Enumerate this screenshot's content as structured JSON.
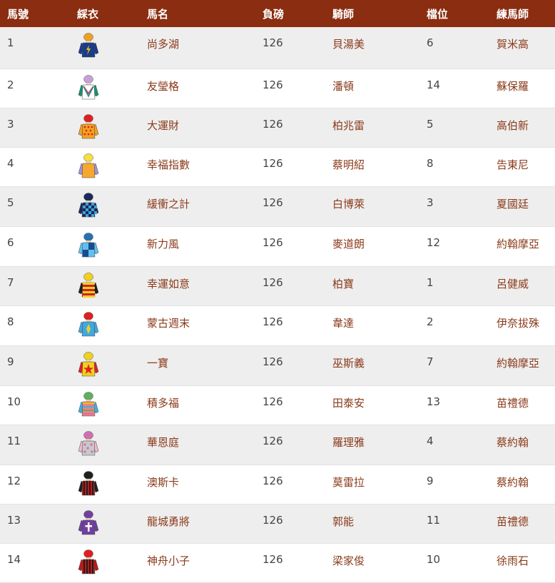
{
  "header": {
    "number": "馬號",
    "silks": "綵衣",
    "horse": "馬名",
    "weight": "負磅",
    "jockey": "騎師",
    "draw": "檔位",
    "trainer": "練馬師"
  },
  "rows": [
    {
      "number": "1",
      "horse": "尚多湖",
      "weight": "126",
      "jockey": "貝湯美",
      "draw": "6",
      "trainer": "賀米高",
      "silk": {
        "icon": "jockey-silks-icon",
        "cap": "#f0a020",
        "body": "#1a3c8c",
        "sleeve": "#1a3c8c",
        "accent": "#f2c200",
        "pattern": "bolt"
      }
    },
    {
      "number": "2",
      "horse": "友瑩格",
      "weight": "126",
      "jockey": "潘頓",
      "draw": "14",
      "trainer": "蘇保羅",
      "silk": {
        "icon": "jockey-silks-icon",
        "cap": "#c8a0d8",
        "body": "#ffffff",
        "sleeve": "#1a9070",
        "accent": "#d04080",
        "pattern": "chevron"
      }
    },
    {
      "number": "3",
      "horse": "大運財",
      "weight": "126",
      "jockey": "柏兆雷",
      "draw": "5",
      "trainer": "高伯新",
      "silk": {
        "icon": "jockey-silks-icon",
        "cap": "#e02020",
        "body": "#f5a020",
        "sleeve": "#f5a020",
        "accent": "#d02020",
        "pattern": "dots"
      }
    },
    {
      "number": "4",
      "horse": "幸福指數",
      "weight": "126",
      "jockey": "蔡明紹",
      "draw": "8",
      "trainer": "告東尼",
      "silk": {
        "icon": "jockey-silks-icon",
        "cap": "#f5e040",
        "body": "#f5a830",
        "sleeve": "#a890d8",
        "accent": "#e07020",
        "pattern": "plain"
      }
    },
    {
      "number": "5",
      "horse": "緩衝之計",
      "weight": "126",
      "jockey": "白博萊",
      "draw": "3",
      "trainer": "夏國廷",
      "silk": {
        "icon": "jockey-silks-icon",
        "cap": "#1a2a5a",
        "body": "#1a2a5a",
        "sleeve": "#1a2a5a",
        "accent": "#40a0d8",
        "pattern": "check"
      }
    },
    {
      "number": "6",
      "horse": "新力風",
      "weight": "126",
      "jockey": "麥道朗",
      "draw": "12",
      "trainer": "約翰摩亞",
      "silk": {
        "icon": "jockey-silks-icon",
        "cap": "#2a70b0",
        "body": "#60c0f0",
        "sleeve": "#60c0f0",
        "accent": "#1a4a90",
        "pattern": "quarter"
      }
    },
    {
      "number": "7",
      "horse": "幸運如意",
      "weight": "126",
      "jockey": "柏寶",
      "draw": "1",
      "trainer": "呂健威",
      "silk": {
        "icon": "jockey-silks-icon",
        "cap": "#f0d020",
        "body": "#d02020",
        "sleeve": "#202020",
        "accent": "#f0d020",
        "pattern": "hoops"
      }
    },
    {
      "number": "8",
      "horse": "蒙古週末",
      "weight": "126",
      "jockey": "韋達",
      "draw": "2",
      "trainer": "伊奈拔殊",
      "silk": {
        "icon": "jockey-silks-icon",
        "cap": "#e02020",
        "body": "#40a8e0",
        "sleeve": "#40a8e0",
        "accent": "#f0d020",
        "pattern": "diamond"
      }
    },
    {
      "number": "9",
      "horse": "一寶",
      "weight": "126",
      "jockey": "巫斯義",
      "draw": "7",
      "trainer": "約翰摩亞",
      "silk": {
        "icon": "jockey-silks-icon",
        "cap": "#f0d020",
        "body": "#f0d020",
        "sleeve": "#e02020",
        "accent": "#e02020",
        "pattern": "star"
      }
    },
    {
      "number": "10",
      "horse": "積多福",
      "weight": "126",
      "jockey": "田泰安",
      "draw": "13",
      "trainer": "苗禮德",
      "silk": {
        "icon": "jockey-silks-icon",
        "cap": "#60b060",
        "body": "#f08080",
        "sleeve": "#40b0e0",
        "accent": "#f0c020",
        "pattern": "stripes"
      }
    },
    {
      "number": "11",
      "horse": "華恩庭",
      "weight": "126",
      "jockey": "羅理雅",
      "draw": "4",
      "trainer": "蔡約翰",
      "silk": {
        "icon": "jockey-silks-icon",
        "cap": "#d070b0",
        "body": "#c8c8c8",
        "sleeve": "#f0b8d0",
        "accent": "#d070b0",
        "pattern": "spots"
      }
    },
    {
      "number": "12",
      "horse": "澳斯卡",
      "weight": "126",
      "jockey": "莫雷拉",
      "draw": "9",
      "trainer": "蔡約翰",
      "silk": {
        "icon": "jockey-silks-icon",
        "cap": "#202020",
        "body": "#c01818",
        "sleeve": "#202020",
        "accent": "#202020",
        "pattern": "vstripes"
      }
    },
    {
      "number": "13",
      "horse": "龍城勇將",
      "weight": "126",
      "jockey": "郭能",
      "draw": "11",
      "trainer": "苗禮德",
      "silk": {
        "icon": "jockey-silks-icon",
        "cap": "#7040a0",
        "body": "#7040a0",
        "sleeve": "#7040a0",
        "accent": "#ffffff",
        "pattern": "cross"
      }
    },
    {
      "number": "14",
      "horse": "神舟小子",
      "weight": "126",
      "jockey": "梁家俊",
      "draw": "10",
      "trainer": "徐雨石",
      "silk": {
        "icon": "jockey-silks-icon",
        "cap": "#e02020",
        "body": "#c01818",
        "sleeve": "#c01818",
        "accent": "#202020",
        "pattern": "vstripes"
      }
    }
  ]
}
